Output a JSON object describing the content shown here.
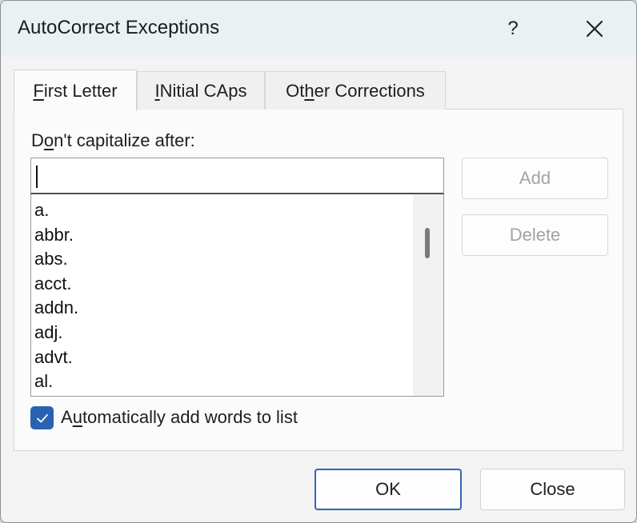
{
  "window": {
    "title": "AutoCorrect Exceptions",
    "help_glyph": "?",
    "close_icon": "close-icon"
  },
  "tabs": [
    {
      "label_pre": "",
      "label_key": "F",
      "label_post": "irst Letter",
      "active": true
    },
    {
      "label_pre": "",
      "label_key": "I",
      "label_post": "Nitial CAps",
      "active": false
    },
    {
      "label_pre": "Ot",
      "label_key": "h",
      "label_post": "er Corrections",
      "active": false
    }
  ],
  "panel": {
    "field_label_pre": "D",
    "field_label_key": "o",
    "field_label_post": "n't capitalize after:",
    "input_value": "",
    "list_items": [
      "a.",
      "abbr.",
      "abs.",
      "acct.",
      "addn.",
      "adj.",
      "advt.",
      "al."
    ],
    "add_label": "Add",
    "delete_label": "Delete",
    "checkbox": {
      "checked": true,
      "label_pre": "A",
      "label_key": "u",
      "label_post": "tomatically add words to list"
    }
  },
  "footer": {
    "ok_label": "OK",
    "close_label": "Close"
  },
  "colors": {
    "accent": "#2a62b3",
    "titlebar": "#e9f1f2",
    "disabled_text": "#a3a3a3"
  }
}
